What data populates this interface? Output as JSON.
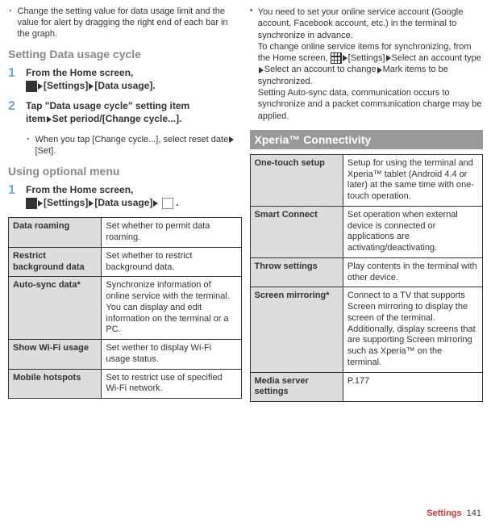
{
  "col1": {
    "bullet1": "Change the setting value for data usage limit and the value for alert by dragging the right end of each bar in the graph.",
    "heading1": "Setting Data usage cycle",
    "step1": {
      "num": "1",
      "pre": "From the Home screen,",
      "part2": "[Settings]",
      "part3": "[Data usage]."
    },
    "step2": {
      "num": "2",
      "line1": "Tap \"Data usage cycle\" setting item",
      "line2": "Set period/[Change cycle...].",
      "sub_pre": "When you tap [Change cycle...], select reset date",
      "sub_post": "[Set]."
    },
    "heading2": "Using optional menu",
    "step3": {
      "num": "1",
      "pre": "From the Home screen,",
      "part2": "[Settings]",
      "part3": "[Data usage]",
      "part4": "."
    },
    "table": {
      "r1": {
        "label": "Data roaming",
        "desc": "Set whether to permit data roaming."
      },
      "r2": {
        "label": "Restrict background data",
        "desc": "Set whether to restrict background data."
      },
      "r3": {
        "label": "Auto-sync data*",
        "desc": "Synchronize information of online service with the terminal. You can display and edit information on the terminal or a PC."
      },
      "r4": {
        "label": "Show Wi-Fi usage",
        "desc": "Set wether to display Wi-Fi usage status."
      },
      "r5": {
        "label": "Mobile hotspots",
        "desc": "Set to restrict use of specified Wi-Fi network."
      }
    }
  },
  "col2": {
    "note": {
      "mark": "*",
      "p1": "You need to set your online service account (Google account, Facebook account, etc.) in the terminal to synchronize in advance.",
      "p2_pre": "To change online service items for synchronizing, from the Home screen,",
      "p2_a": "[Settings]",
      "p2_b": "Select an account type",
      "p2_c": "Select an account to change",
      "p2_d": "Mark items to be synchronized.",
      "p3": "Setting Auto-sync data, communication occurs to synchronize and a packet communication charge may be applied."
    },
    "banner": "Xperia™ Connectivity",
    "table": {
      "r1": {
        "label": "One-touch setup",
        "desc": "Setup for using the terminal and Xperia™ tablet (Android 4.4 or later) at the same time with one-touch operation."
      },
      "r2": {
        "label": "Smart Connect",
        "desc": "Set operation when external device is connected or applications are activating/deactivating."
      },
      "r3": {
        "label": "Throw settings",
        "desc": "Play contents in the terminal with other device."
      },
      "r4": {
        "label": "Screen mirroring*",
        "desc": "Connect to a TV that supports Screen mirroring to display the screen of the terminal. Additionally, display screens that are supporting Screen mirroring such as Xperia™ on the terminal."
      },
      "r5": {
        "label": "Media server settings",
        "desc": "P.177"
      }
    }
  },
  "footer": {
    "label": "Settings",
    "page": "141"
  }
}
